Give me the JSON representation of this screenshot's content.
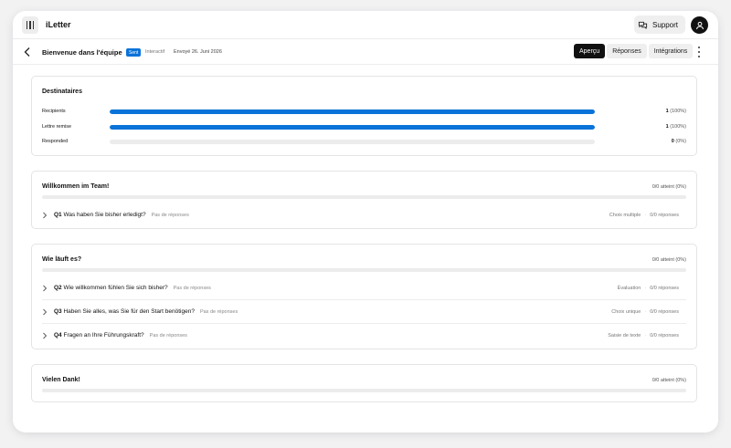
{
  "app": {
    "brand": "iLetter"
  },
  "header": {
    "support_label": "Support"
  },
  "letter": {
    "title": "Bienvenue dans l'équipe",
    "status_badge": "Sent",
    "type": "Interactif",
    "sent_date": "Envoyé 26. Juni 2026"
  },
  "tabs": [
    {
      "label": "Aperçu",
      "active": true
    },
    {
      "label": "Réponses",
      "active": false
    },
    {
      "label": "Intégrations",
      "active": false
    }
  ],
  "recipients": {
    "title": "Destinataires",
    "rows": [
      {
        "label": "Recipients",
        "count": "1",
        "percent_label": "(100%)",
        "fill_percent": 100
      },
      {
        "label": "Lettre remise",
        "count": "1",
        "percent_label": "(100%)",
        "fill_percent": 100
      },
      {
        "label": "Responded",
        "count": "0",
        "percent_label": "(0%)",
        "fill_percent": 0
      }
    ]
  },
  "sections": [
    {
      "title": "Willkommen im Team!",
      "score": "0/0 atteint (0%)",
      "fill_percent": 0,
      "questions": [
        {
          "num": "Q1",
          "text": "Was haben Sie bisher erledigt?",
          "status": "Pas de réponses",
          "type": "Choix multiple",
          "responses": "0/0 réponses"
        }
      ]
    },
    {
      "title": "Wie läuft es?",
      "score": "0/0 atteint (0%)",
      "fill_percent": 0,
      "questions": [
        {
          "num": "Q2",
          "text": "Wie willkommen fühlen Sie sich bisher?",
          "status": "Pas de réponses",
          "type": "Évaluation",
          "responses": "0/0 réponses"
        },
        {
          "num": "Q3",
          "text": "Haben Sie alles, was Sie für den Start benötigen?",
          "status": "Pas de réponses",
          "type": "Choix unique",
          "responses": "0/0 réponses"
        },
        {
          "num": "Q4",
          "text": "Fragen an Ihre Führungskraft?",
          "status": "Pas de réponses",
          "type": "Saisie de texte",
          "responses": "0/0 réponses"
        }
      ]
    },
    {
      "title": "Vielen Dank!",
      "score": "0/0 atteint (0%)",
      "fill_percent": 0,
      "questions": []
    }
  ],
  "colors": {
    "accent": "#0a73d9",
    "track": "#ececec"
  }
}
